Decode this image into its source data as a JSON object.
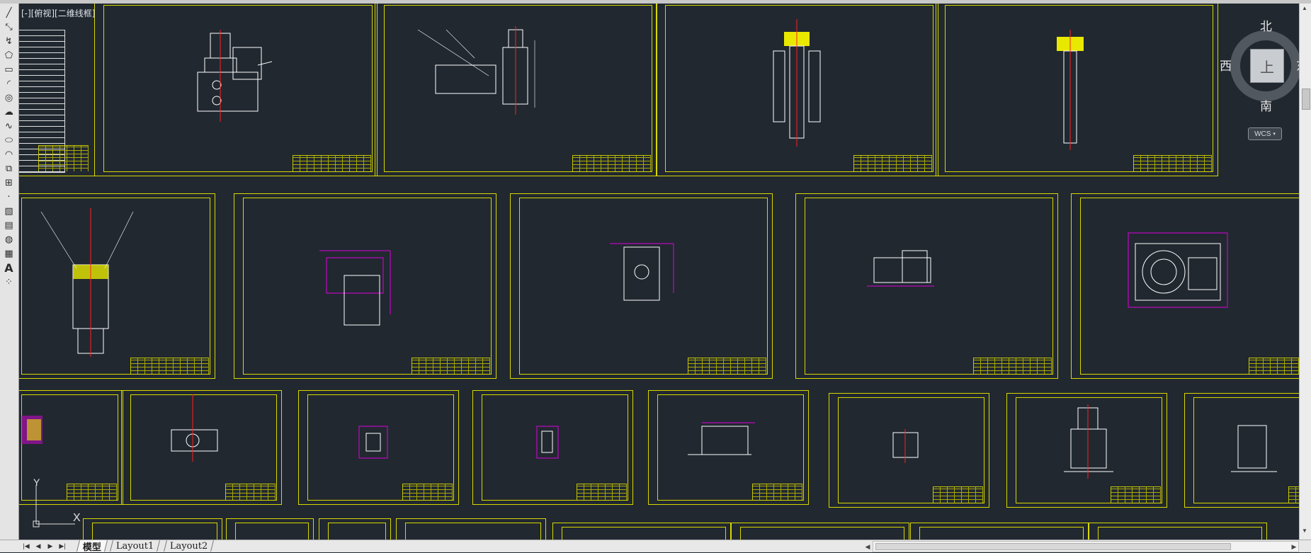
{
  "viewport": {
    "label": "[-][俯视][二维线框]"
  },
  "viewcube": {
    "north": "北",
    "south": "南",
    "east": "东",
    "west": "西",
    "top_face": "上",
    "wcs": "WCS"
  },
  "ucs": {
    "x": "X",
    "y": "Y"
  },
  "tabs": [
    {
      "label": "模型",
      "active": true
    },
    {
      "label": "Layout1",
      "active": false
    },
    {
      "label": "Layout2",
      "active": false
    }
  ],
  "toolbar": {
    "tools": [
      "line-tool",
      "construction-line-tool",
      "polyline-tool",
      "polygon-tool",
      "rectangle-tool",
      "arc-tool",
      "circle-tool",
      "revision-cloud-tool",
      "spline-tool",
      "ellipse-tool",
      "ellipse-arc-tool",
      "insert-block-tool",
      "make-block-tool",
      "point-tool",
      "hatch-tool",
      "gradient-tool",
      "region-tool",
      "table-tool",
      "multiline-text-tool",
      "add-selected-tool"
    ],
    "text_tool_glyph": "A"
  },
  "colors": {
    "background": "#212830",
    "sheet_border": "#d8d800",
    "dimension": "#e000e0",
    "geometry": "#ffffff",
    "centerline": "#ff2020"
  }
}
